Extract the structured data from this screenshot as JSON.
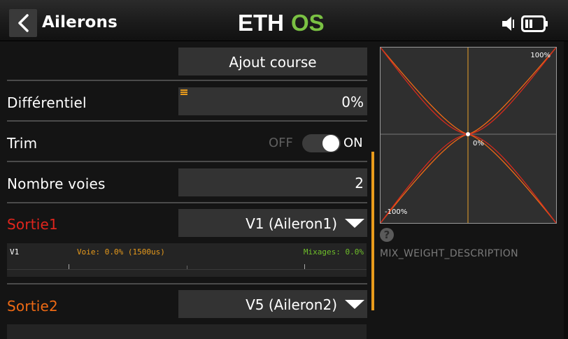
{
  "header": {
    "title": "Ailerons",
    "logo_text": "ETHOS"
  },
  "colors": {
    "accent": "#e89b1c",
    "output1": "#e0251d",
    "output2": "#ee6a14",
    "logo_green": "#7ac143",
    "mix_green": "#6fbf2a"
  },
  "form": {
    "add_travel_label": "Ajout course",
    "differential": {
      "label": "Différentiel",
      "value": "0%"
    },
    "trim": {
      "label": "Trim",
      "off_text": "OFF",
      "on_text": "ON",
      "state": "ON"
    },
    "channels": {
      "label": "Nombre voies",
      "value": "2"
    },
    "output1": {
      "label": "Sortie1",
      "value": "V1 (Aileron1)",
      "bar": {
        "name": "V1",
        "channel_text": "Voie: 0.0% (1500us)",
        "mix_text": "Mixages: 0.0%"
      }
    },
    "output2": {
      "label": "Sortie2",
      "value": "V5 (Aileron2)"
    }
  },
  "graph": {
    "top_right_label": "100%",
    "center_label": "0%",
    "bottom_left_label": "-100%"
  },
  "help": {
    "icon": "help-circle-icon",
    "description": "MIX_WEIGHT_DESCRIPTION"
  }
}
